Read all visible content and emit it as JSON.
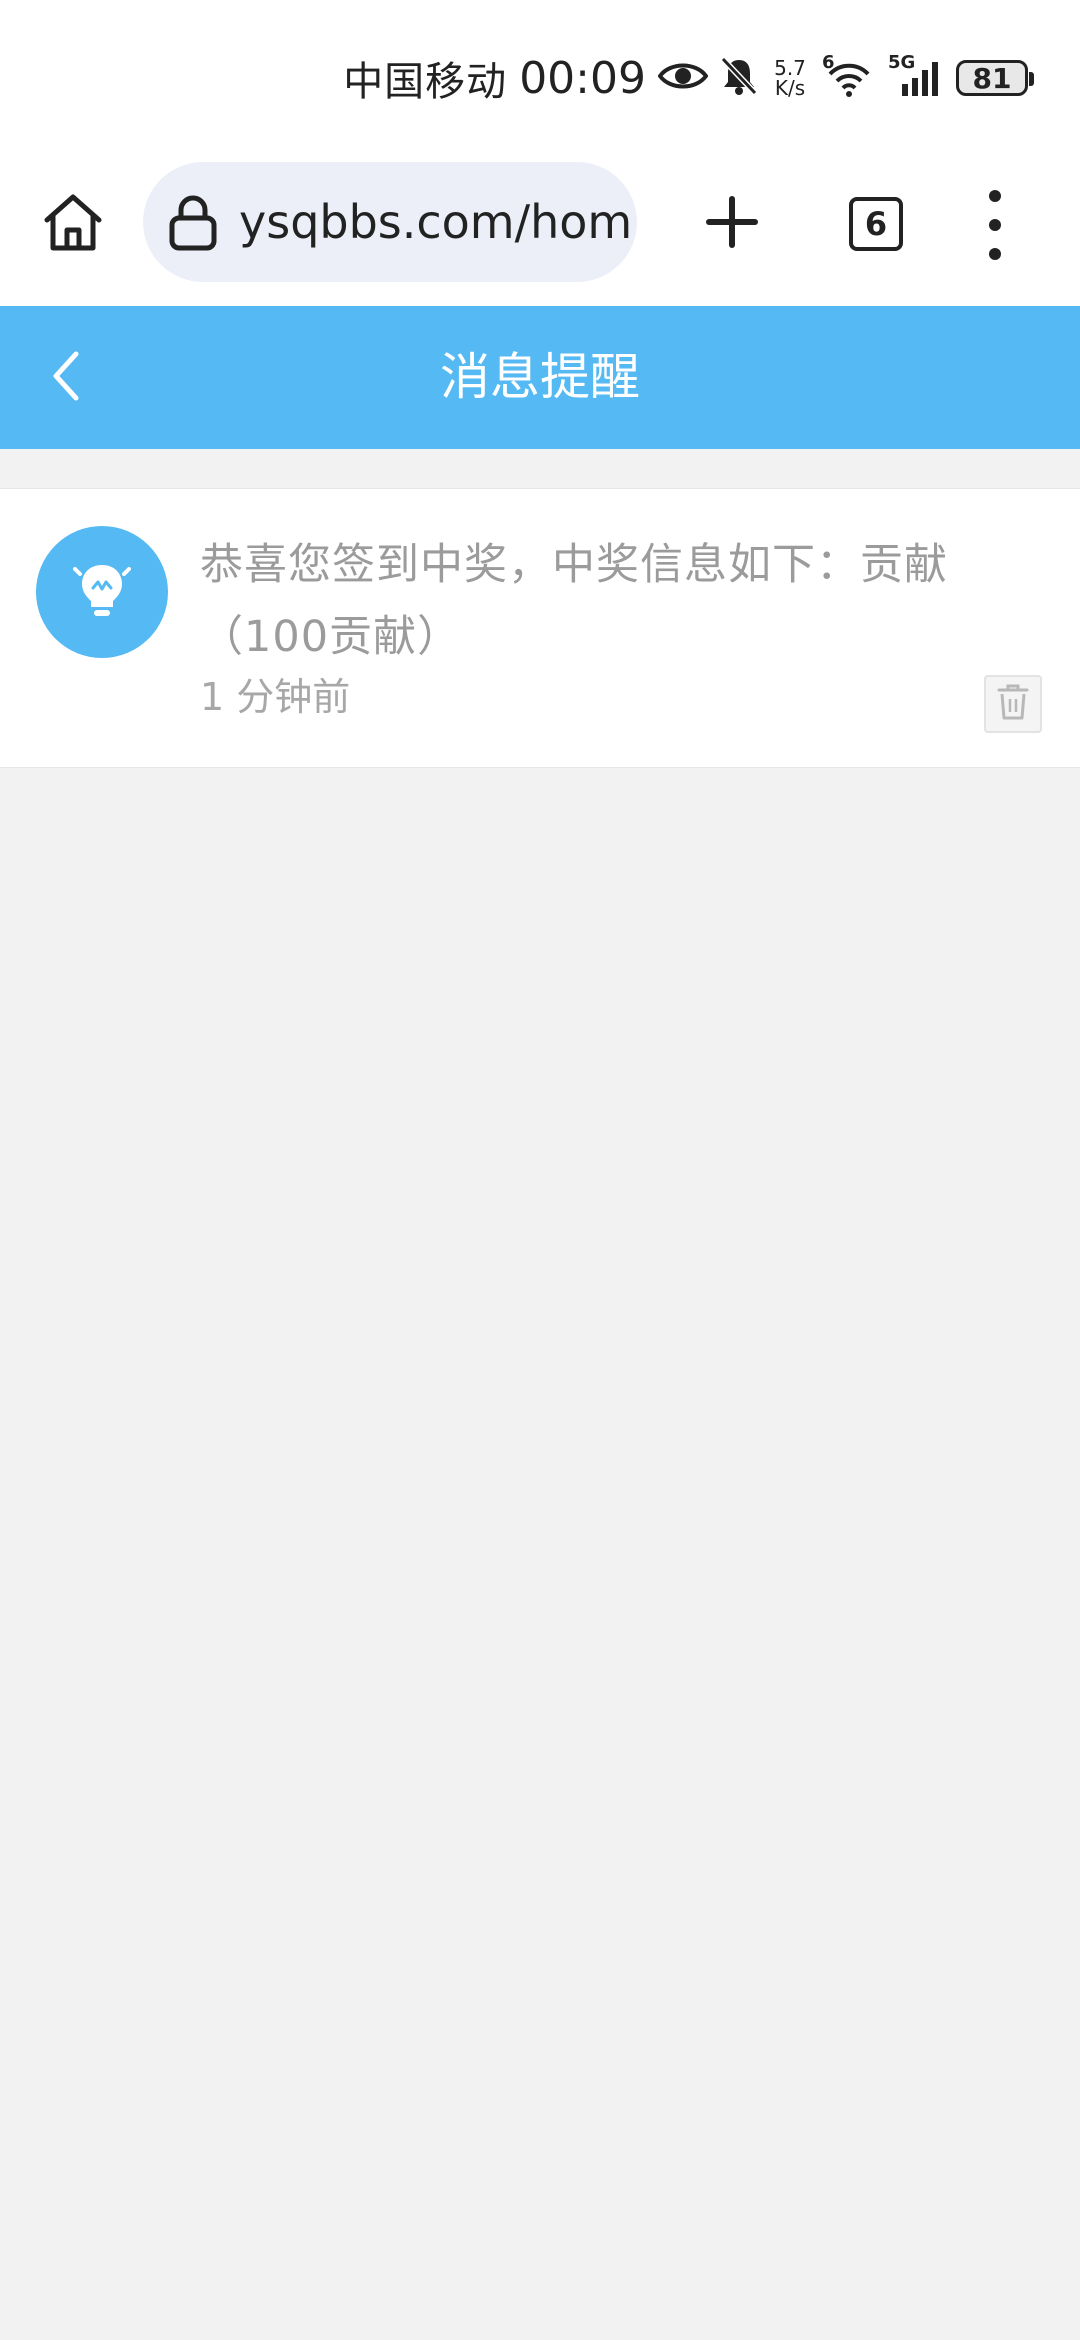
{
  "status_bar": {
    "carrier": "中国移动",
    "time": "00:09",
    "net_speed_value": "5.7",
    "net_speed_unit": "K/s",
    "wifi_badge": "6",
    "cell_badge": "5G",
    "battery": "81",
    "icons": [
      "eye-icon",
      "bell-muted-icon",
      "wifi-icon",
      "signal-icon",
      "battery-icon"
    ]
  },
  "browser": {
    "url": "ysqbbs.com/hom",
    "tab_count": "6",
    "icons": [
      "home-icon",
      "lock-icon",
      "plus-icon",
      "more-vertical-icon"
    ]
  },
  "header": {
    "title": "消息提醒",
    "accent_color": "#55b9f3",
    "back_icon": "chevron-left-icon"
  },
  "messages": [
    {
      "text": "恭喜您签到中奖，中奖信息如下：贡献（100贡献）",
      "time": "1 分钟前",
      "icon": "lightbulb-icon",
      "delete_icon": "trash-icon"
    }
  ]
}
